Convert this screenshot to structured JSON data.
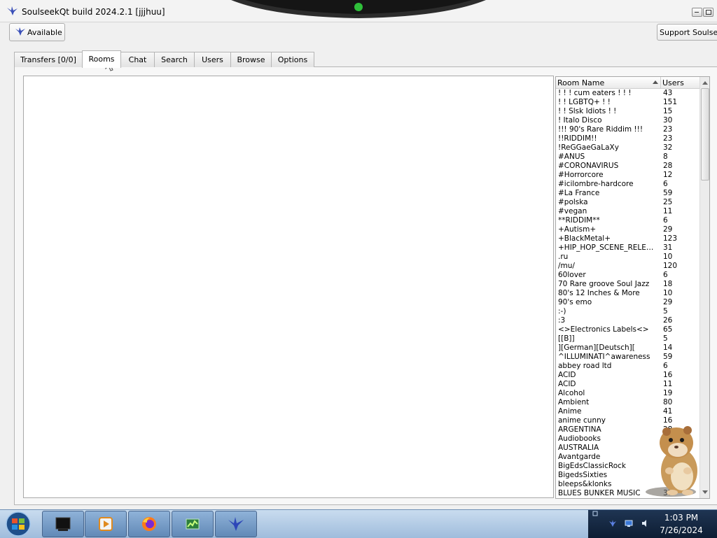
{
  "window": {
    "title": "SoulseekQt build 2024.2.1 [jjjhuu]"
  },
  "toolbar": {
    "status_label": "Available",
    "support_label": "Support Soulseek"
  },
  "tabs": [
    {
      "label": "Transfers [0/0]",
      "active": false
    },
    {
      "label": "Rooms",
      "active": true
    },
    {
      "label": "Chat",
      "active": false
    },
    {
      "label": "Search",
      "active": false
    },
    {
      "label": "Users",
      "active": false
    },
    {
      "label": "Browse",
      "active": false
    },
    {
      "label": "Options",
      "active": false
    }
  ],
  "room_list": {
    "columns": {
      "name": "Room Name",
      "users": "Users"
    },
    "rows": [
      {
        "name": "! ! ! cum eaters ! ! !",
        "users": "43"
      },
      {
        "name": "! ! LGBTQ+ ! !",
        "users": "151"
      },
      {
        "name": "! ! Slsk Idiots ! !",
        "users": "15"
      },
      {
        "name": "! Italo Disco",
        "users": "30"
      },
      {
        "name": "!!! 90's Rare Riddim !!!",
        "users": "23"
      },
      {
        "name": "!!RIDDIM!!",
        "users": "23"
      },
      {
        "name": "!ReGGaeGaLaXy",
        "users": "32"
      },
      {
        "name": "#ANUS",
        "users": "8"
      },
      {
        "name": "#CORONAVIRUS",
        "users": "28"
      },
      {
        "name": "#Horrorcore",
        "users": "12"
      },
      {
        "name": "#icilombre-hardcore",
        "users": "6"
      },
      {
        "name": "#La France",
        "users": "59"
      },
      {
        "name": "#polska",
        "users": "25"
      },
      {
        "name": "#vegan",
        "users": "11"
      },
      {
        "name": "**RIDDIM**",
        "users": "6"
      },
      {
        "name": "+Autism+",
        "users": "29"
      },
      {
        "name": "+BlackMetal+",
        "users": "123"
      },
      {
        "name": "+HIP_HOP_SCENE_RELEAS...",
        "users": "31"
      },
      {
        "name": ".ru",
        "users": "10"
      },
      {
        "name": "/mu/",
        "users": "120"
      },
      {
        "name": "60lover",
        "users": "6"
      },
      {
        "name": "70 Rare groove Soul Jazz",
        "users": "18"
      },
      {
        "name": "80's 12 Inches & More",
        "users": "10"
      },
      {
        "name": "90's emo",
        "users": "29"
      },
      {
        "name": ":-)",
        "users": "5"
      },
      {
        "name": ":3",
        "users": "26"
      },
      {
        "name": "<>Electronics Labels<>",
        "users": "65"
      },
      {
        "name": "[[B]]",
        "users": "5"
      },
      {
        "name": "][German][Deutsch][",
        "users": "14"
      },
      {
        "name": "^ILLUMINATI^awareness",
        "users": "59"
      },
      {
        "name": "abbey road ltd",
        "users": "6"
      },
      {
        "name": "ACID",
        "users": "16"
      },
      {
        "name": "ACID",
        "users": "11"
      },
      {
        "name": "Alcohol",
        "users": "19"
      },
      {
        "name": "Ambient",
        "users": "80"
      },
      {
        "name": "Anime",
        "users": "41"
      },
      {
        "name": "anime cunny",
        "users": "16"
      },
      {
        "name": "ARGENTINA",
        "users": "28"
      },
      {
        "name": "Audiobooks",
        "users": ""
      },
      {
        "name": "AUSTRALIA",
        "users": ""
      },
      {
        "name": "Avantgarde",
        "users": ""
      },
      {
        "name": "BigEdsClassicRock",
        "users": ""
      },
      {
        "name": "BigedsSixties",
        "users": ""
      },
      {
        "name": "bleeps&klonks",
        "users": ""
      },
      {
        "name": "BLUES BUNKER MUSIC",
        "users": "37"
      }
    ]
  },
  "taskbar": {
    "time": "1:03 PM",
    "date": "7/26/2024"
  }
}
